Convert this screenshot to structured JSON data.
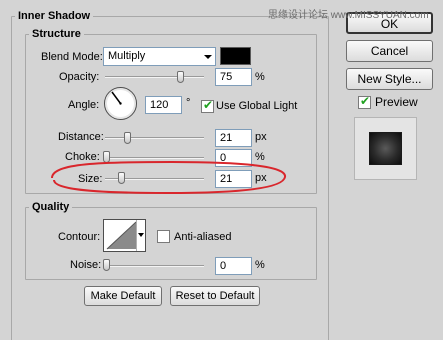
{
  "panel": {
    "title": "Inner Shadow",
    "watermark": "思缘设计论坛 www.MISSYUAN.com"
  },
  "structure": {
    "title": "Structure",
    "blend_mode_label": "Blend Mode:",
    "blend_mode_value": "Multiply",
    "shadow_color": "#000000",
    "opacity_label": "Opacity:",
    "opacity_value": "75",
    "opacity_unit": "%",
    "opacity_level": 75,
    "angle_label": "Angle:",
    "angle_value": "120",
    "angle_unit": "°",
    "use_global_light_label": "Use Global Light",
    "use_global_light_checked": true,
    "distance_label": "Distance:",
    "distance_value": "21",
    "distance_unit": "px",
    "choke_label": "Choke:",
    "choke_value": "0",
    "choke_unit": "%",
    "size_label": "Size:",
    "size_value": "21",
    "size_unit": "px",
    "highlight_color": "#d9262c"
  },
  "quality": {
    "title": "Quality",
    "contour_label": "Contour:",
    "anti_aliased_label": "Anti-aliased",
    "anti_aliased_checked": false,
    "noise_label": "Noise:",
    "noise_value": "0",
    "noise_unit": "%"
  },
  "buttons": {
    "make_default": "Make Default",
    "reset_default": "Reset to Default",
    "ok": "OK",
    "cancel": "Cancel",
    "new_style": "New Style...",
    "preview_label": "Preview",
    "preview_checked": true
  }
}
